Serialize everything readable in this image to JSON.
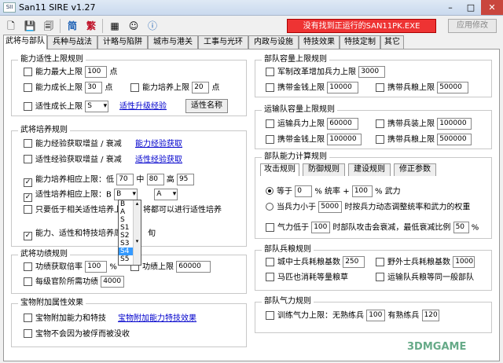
{
  "window": {
    "title": "San11 SIRE v1.27",
    "min": "–",
    "max": "□",
    "close": "✕"
  },
  "toolbar": {
    "new": "🗋",
    "save": "💾",
    "saveas": "🗐",
    "simp": "简",
    "trad": "繁",
    "calc": "▦",
    "face": "☺",
    "info": "ⓘ"
  },
  "status_msg": "没有找到正运行的SAN11PK.EXE",
  "apply_label": "应用修改",
  "tabs": [
    "武将与部队",
    "兵种与战法",
    "计略与陷阱",
    "城市与港关",
    "工事与光环",
    "内政与设施",
    "特技效果",
    "特技定制",
    "其它"
  ],
  "g1": {
    "title": "能力适性上限规则",
    "l1": "能力最大上限",
    "v1": "100",
    "u1": "点",
    "l2": "能力成长上限",
    "v2": "30",
    "u2": "点",
    "l3": "能力培养上限",
    "v3": "20",
    "u3": "点",
    "l4": "适性成长上限",
    "v4": "S",
    "link": "适性升级经验",
    "btn": "适性名称"
  },
  "g2": {
    "title": "武将培养规则",
    "l1": "能力经验获取增益 / 衰减",
    "link1": "能力经验获取",
    "l2": "适性经验获取增益 / 衰减",
    "link2": "适性经验获取",
    "l3": "能力培养相应上限：低",
    "v_low": "70",
    "l_mid": "中",
    "v_mid": "80",
    "l_high": "高",
    "v_high": "95",
    "l4": "适性培养相应上限：B",
    "v4a": "B",
    "v4b": "A",
    "l5": "只要低于相关适性培养上",
    "l5b": "将都可以进行适性培养",
    "l6": "能力、适性和特技培养周",
    "l6b": "旬"
  },
  "dropdown": [
    "B",
    "A",
    "S",
    "S1",
    "S2",
    "S3",
    "S4",
    "S5"
  ],
  "g3": {
    "title": "武将功绩规则",
    "l1": "功绩获取倍率",
    "v1": "100",
    "u1": "%",
    "l2": "功绩上限",
    "v2": "60000",
    "l3": "每级官阶所需功绩",
    "v3": "4000"
  },
  "g4": {
    "title": "宝物附加属性效果",
    "l1": "宝物附加能力和特技",
    "link": "宝物附加能力特技效果",
    "l2": "宝物不会因为被俘而被没收"
  },
  "g5": {
    "title": "部队容量上限规则",
    "l1": "军制改革增加兵力上限",
    "v1": "3000",
    "l2": "携带金钱上限",
    "v2": "10000",
    "l3": "携带兵粮上限",
    "v3": "50000"
  },
  "g6": {
    "title": "运输队容量上限规则",
    "l1": "运输兵力上限",
    "v1": "60000",
    "l2": "携带兵装上限",
    "v2": "100000",
    "l3": "携带金钱上限",
    "v3": "100000",
    "l4": "携带兵粮上限",
    "v4": "500000"
  },
  "g7": {
    "title": "部队能力计算规则",
    "subtabs": [
      "攻击规则",
      "防御规则",
      "建设规则",
      "修正参数"
    ],
    "l1": "等于",
    "v1a": "0",
    "t1": "% 统率 +",
    "v1b": "100",
    "t1b": "% 武力",
    "l2": "当兵力小于",
    "v2": "5000",
    "t2": "时按兵力动态调整统率和武力的权重",
    "l3": "气力低于",
    "v3": "100",
    "t3": "时部队攻击会衰减，最低衰减比例",
    "v3b": "50",
    "t3b": "%"
  },
  "g8": {
    "title": "部队兵粮规则",
    "l1": "城中士兵耗粮基数",
    "v1": "250",
    "l2": "野外士兵耗粮基数",
    "v2": "1000",
    "l3": "马匹也消耗等量粮草",
    "l4": "运输队兵粮等同一般部队"
  },
  "g9": {
    "title": "部队气力规则",
    "l1": "训练气力上限：无熟练兵",
    "v1": "100",
    "l2": "有熟练兵",
    "v2": "120"
  },
  "watermark": "3DMGAME"
}
